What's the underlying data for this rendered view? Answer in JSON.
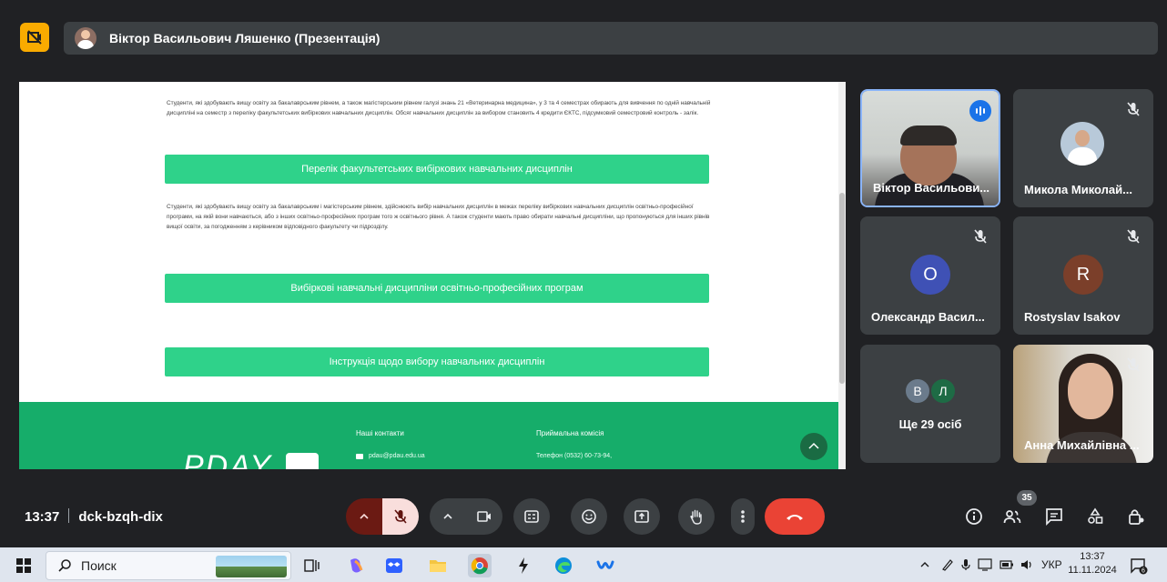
{
  "presenter": {
    "name": "Віктор Васильович Ляшенко (Презентація)"
  },
  "shared_page": {
    "paragraph1": "Студенти, які здобувають вищу освіту за бакалаврським рівнем, а також магістерським рівнем галузі знань 21 «Ветеринарна медицина», у 3 та 4 семестрах обирають для вивчення по одній навчальній дисципліні на семестр з переліку факультетських вибіркових навчальних дисциплін. Обсяг навчальних дисциплін за вибором становить 4 кредити ЄКТС, підсумковий семестровий контроль - залік.",
    "button1": "Перелік факультетських вибіркових навчальних дисциплін",
    "paragraph2": "Студенти, які здобувають вищу освіту за бакалаврським і магістерським рівнем, здійснюють вибір навчальних дисциплін в межах переліку вибіркових навчальних дисциплін освітньо-професійної програми, на якій вони навчаються, або з інших освітньо-професійних програм того ж освітнього рівня. А також студенти мають право обирати навчальні дисципліни, що пропонуються для інших рівнів вищої освіти, за погодженням з керівником відповідного факультету чи підрозділу.",
    "button2": "Вибіркові навчальні дисципліни освітньо-професійних програм",
    "button3": "Інструкція щодо вибору навчальних дисциплін",
    "footer": {
      "contacts_title": "Наші контакти",
      "email": "pdau@pdau.edu.ua",
      "admission_title": "Приймальна комісія",
      "phone": "Телефон (0532) 60-73-94,",
      "logo": "PDAY"
    }
  },
  "participants": [
    {
      "name": "Віктор Васильови...",
      "state": "speaking"
    },
    {
      "name": "Микола Миколай...",
      "state": "muted"
    },
    {
      "name": "Олександр Васил...",
      "initial": "О",
      "color": "#3f51b5",
      "state": "muted"
    },
    {
      "name": "Rostyslav Isakov",
      "initial": "R",
      "color": "#7b3f2a",
      "state": "muted"
    },
    {
      "more_label": "Ще 29 осіб",
      "initials": [
        "В",
        "Л"
      ],
      "colors": [
        "#6b7b8c",
        "#1e6b45"
      ]
    },
    {
      "name": "Анна Михайлівна ...",
      "state": "muted"
    }
  ],
  "meeting": {
    "time": "13:37",
    "code": "dck-bzqh-dix",
    "people_count": "35"
  },
  "taskbar": {
    "search_placeholder": "Поиск",
    "language": "УКР",
    "clock_time": "13:37",
    "clock_date": "11.11.2024",
    "notification_count": "6"
  },
  "colors": {
    "accent_green": "#2fd28a",
    "footer_green": "#16ad6a",
    "hangup_red": "#ea4335",
    "tile_bg": "#3c4043",
    "meet_bg": "#202124"
  }
}
